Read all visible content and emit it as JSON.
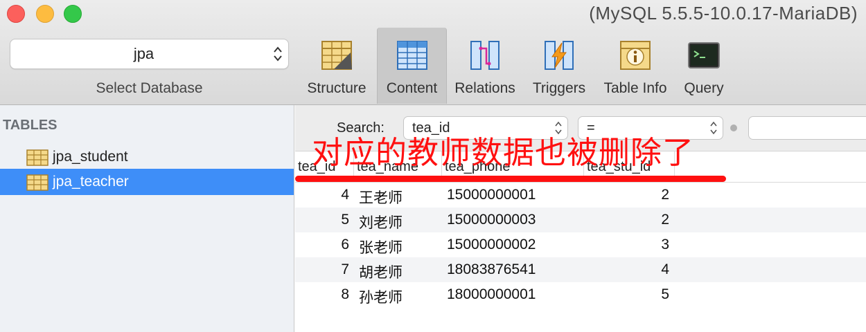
{
  "window": {
    "title": "(MySQL 5.5.5-10.0.17-MariaDB)"
  },
  "toolbar": {
    "database_value": "jpa",
    "database_caption": "Select Database",
    "buttons": [
      {
        "label": "Structure",
        "icon": "structure-icon"
      },
      {
        "label": "Content",
        "icon": "content-icon",
        "active": true
      },
      {
        "label": "Relations",
        "icon": "relations-icon"
      },
      {
        "label": "Triggers",
        "icon": "triggers-icon"
      },
      {
        "label": "Table Info",
        "icon": "table-info-icon"
      },
      {
        "label": "Query",
        "icon": "query-icon"
      }
    ]
  },
  "sidebar": {
    "heading": "TABLES",
    "items": [
      {
        "label": "jpa_student",
        "selected": false
      },
      {
        "label": "jpa_teacher",
        "selected": true
      }
    ]
  },
  "filter": {
    "search_label": "Search:",
    "field_value": "tea_id",
    "operator_value": "=",
    "value": ""
  },
  "table": {
    "columns": [
      "tea_id",
      "tea_name",
      "tea_phone",
      "tea_stu_id"
    ],
    "rows": [
      [
        "4",
        "王老师",
        "15000000001",
        "2"
      ],
      [
        "5",
        "刘老师",
        "15000000003",
        "2"
      ],
      [
        "6",
        "张老师",
        "15000000002",
        "3"
      ],
      [
        "7",
        "胡老师",
        "18083876541",
        "4"
      ],
      [
        "8",
        "孙老师",
        "18000000001",
        "5"
      ]
    ]
  },
  "annotation": {
    "text": "对应的教师数据也被删除了",
    "color": "#ff1010"
  },
  "colors": {
    "selection": "#3e8ef8",
    "toolbar_bg": "#e2e2e2",
    "sidebar_bg": "#eef1f5"
  }
}
